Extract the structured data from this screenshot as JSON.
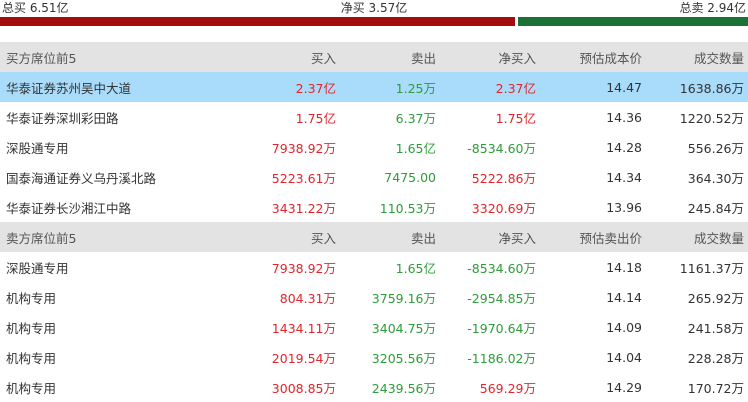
{
  "summary": {
    "total_buy": "总买 6.51亿",
    "net_buy": "净买 3.57亿",
    "total_sell": "总卖 2.94亿",
    "buy_color": "#a50c0c",
    "sell_color": "#1b7237"
  },
  "buy_section": {
    "headers": [
      "买方席位前5",
      "买入",
      "卖出",
      "净买入",
      "预估成本价",
      "成交数量"
    ],
    "rows": [
      [
        "华泰证券苏州吴中大道",
        "2.37亿",
        "1.25万",
        "2.37亿",
        "14.47",
        "1638.86万"
      ],
      [
        "华泰证券深圳彩田路",
        "1.75亿",
        "6.37万",
        "1.75亿",
        "14.36",
        "1220.52万"
      ],
      [
        "深股通专用",
        "7938.92万",
        "1.65亿",
        "-8534.60万",
        "14.28",
        "556.26万"
      ],
      [
        "国泰海通证券义乌丹溪北路",
        "5223.61万",
        "7475.00",
        "5222.86万",
        "14.34",
        "364.30万"
      ],
      [
        "华泰证券长沙湘江中路",
        "3431.22万",
        "110.53万",
        "3320.69万",
        "13.96",
        "245.84万"
      ]
    ]
  },
  "sell_section": {
    "headers": [
      "卖方席位前5",
      "买入",
      "卖出",
      "净买入",
      "预估卖出价",
      "成交数量"
    ],
    "rows": [
      [
        "深股通专用",
        "7938.92万",
        "1.65亿",
        "-8534.60万",
        "14.18",
        "1161.37万"
      ],
      [
        "机构专用",
        "804.31万",
        "3759.16万",
        "-2954.85万",
        "14.14",
        "265.92万"
      ],
      [
        "机构专用",
        "1434.11万",
        "3404.75万",
        "-1970.64万",
        "14.09",
        "241.58万"
      ],
      [
        "机构专用",
        "2019.54万",
        "3205.56万",
        "-1186.02万",
        "14.04",
        "228.28万"
      ],
      [
        "机构专用",
        "3008.85万",
        "2439.56万",
        "569.29万",
        "14.29",
        "170.72万"
      ]
    ]
  },
  "colors": {
    "up": "#e0262d",
    "down": "#2e9c3a",
    "header_bg": "#e3e3e3",
    "highlight_bg": "#a9dcfa"
  }
}
